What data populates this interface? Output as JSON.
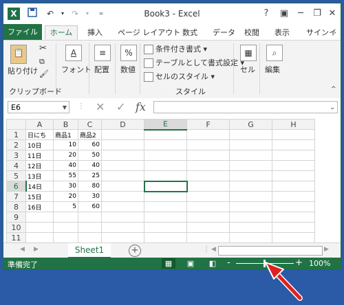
{
  "window": {
    "title": "Book3 - Excel",
    "help": "?",
    "icons": [
      "excel-icon",
      "save-icon",
      "undo-icon",
      "redo-icon",
      "customize-icon"
    ]
  },
  "tabs": [
    "ファイル",
    "ホーム",
    "挿入",
    "ページ レイアウト",
    "数式",
    "データ",
    "校閲",
    "表示",
    "サインイ"
  ],
  "ribbon": {
    "paste": "貼り付け",
    "clipboard": "クリップボード",
    "font": "フォント",
    "alignment": "配置",
    "number": "数値",
    "number_symbol": "%",
    "conditional": "条件付き書式 ▾",
    "table_format": "テーブルとして書式設定 ▾",
    "cell_styles": "セルのスタイル ▾",
    "styles": "スタイル",
    "cells": "セル",
    "editing": "編集"
  },
  "formula_bar": {
    "name_box": "E6",
    "cancel": "✕",
    "enter": "✓",
    "fx": "fx",
    "value": ""
  },
  "grid": {
    "columns": [
      "A",
      "B",
      "C",
      "D",
      "E",
      "F",
      "G",
      "H"
    ],
    "rows": [
      [
        "日にち",
        "商品1",
        "商品2",
        "",
        "",
        "",
        "",
        ""
      ],
      [
        "10日",
        "10",
        "60",
        "",
        "",
        "",
        "",
        ""
      ],
      [
        "11日",
        "20",
        "50",
        "",
        "",
        "",
        "",
        ""
      ],
      [
        "12日",
        "40",
        "40",
        "",
        "",
        "",
        "",
        ""
      ],
      [
        "13日",
        "55",
        "25",
        "",
        "",
        "",
        "",
        ""
      ],
      [
        "14日",
        "30",
        "80",
        "",
        "",
        "",
        "",
        ""
      ],
      [
        "15日",
        "20",
        "30",
        "",
        "",
        "",
        "",
        ""
      ],
      [
        "16日",
        "5",
        "60",
        "",
        "",
        "",
        "",
        ""
      ],
      [
        "",
        "",
        "",
        "",
        "",
        "",
        "",
        ""
      ],
      [
        "",
        "",
        "",
        "",
        "",
        "",
        "",
        ""
      ],
      [
        "",
        "",
        "",
        "",
        "",
        "",
        "",
        ""
      ]
    ],
    "row_numbers": [
      "1",
      "2",
      "3",
      "4",
      "5",
      "6",
      "7",
      "8",
      "9",
      "10",
      "11"
    ],
    "selected_cell": "E6"
  },
  "sheets": {
    "active": "Sheet1",
    "add": "+"
  },
  "status": {
    "text": "準備完了",
    "zoom_minus": "-",
    "zoom_plus": "+",
    "zoom": "100%",
    "zoom_fraction": 0.5
  },
  "colors": {
    "accent": "#217346",
    "desktop": "#2b5aa6",
    "arrow": "#e02020"
  }
}
